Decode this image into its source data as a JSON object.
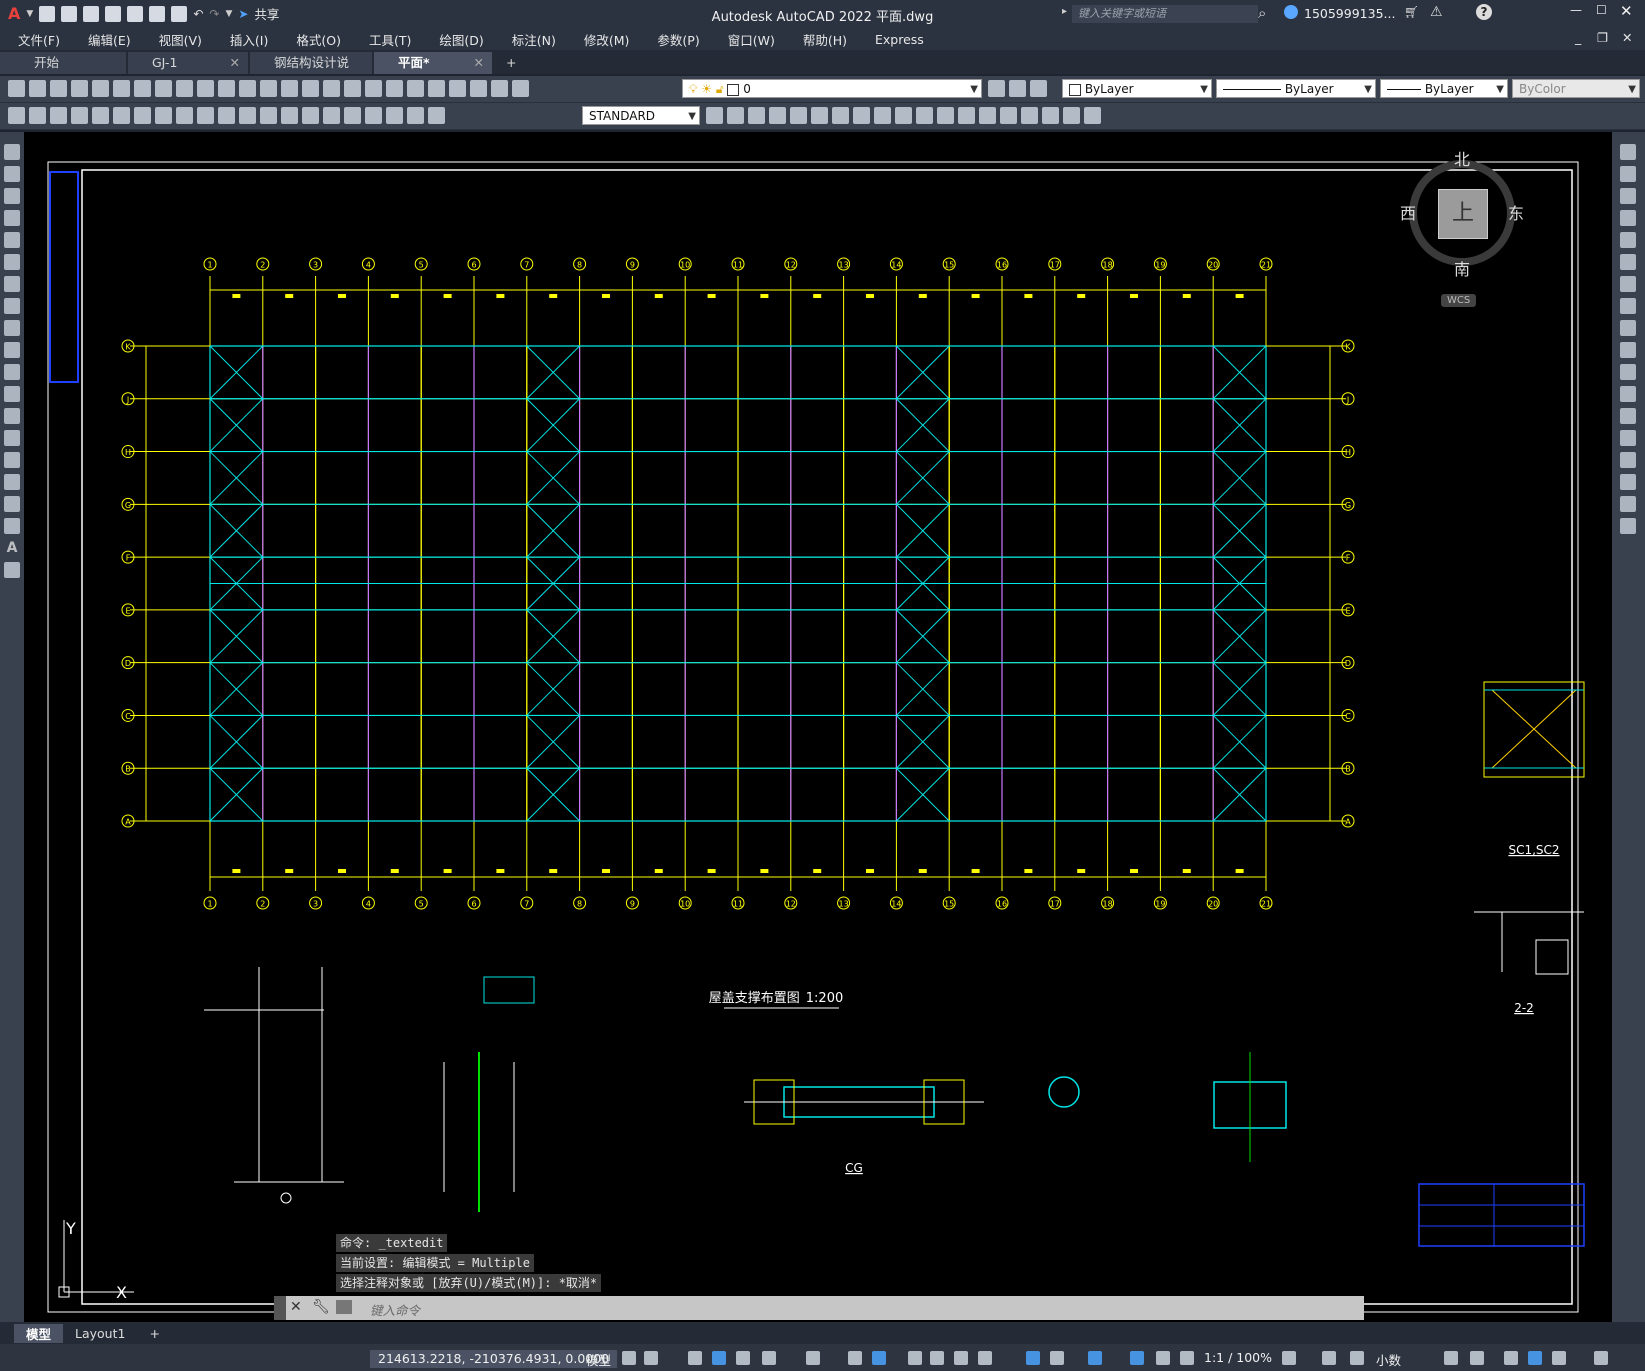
{
  "titlebar": {
    "app_title": "Autodesk AutoCAD 2022    平面.dwg",
    "share_label": "共享",
    "search_placeholder": "键入关键字或短语",
    "user_name": "1505999135...",
    "help_icon": "help-icon"
  },
  "menu": [
    "文件(F)",
    "编辑(E)",
    "视图(V)",
    "插入(I)",
    "格式(O)",
    "工具(T)",
    "绘图(D)",
    "标注(N)",
    "修改(M)",
    "参数(P)",
    "窗口(W)",
    "帮助(H)",
    "Express"
  ],
  "tabs": [
    {
      "label": "开始",
      "active": false,
      "closable": false
    },
    {
      "label": "GJ-1",
      "active": false,
      "closable": true
    },
    {
      "label": "钢结构设计说明",
      "active": false,
      "closable": true
    },
    {
      "label": "平面*",
      "active": true,
      "closable": true
    }
  ],
  "layer_toolbar": {
    "layer_value": "0",
    "color_value": "ByLayer",
    "linetype_value": "ByLayer",
    "lineweight_value": "ByLayer",
    "plotstyle_value": "ByColor",
    "textstyle_value": "STANDARD"
  },
  "viewcube": {
    "north": "北",
    "south": "南",
    "east": "东",
    "west": "西",
    "face": "上",
    "wcs_label": "WCS"
  },
  "drawing": {
    "title": "屋盖支撑布置图",
    "scale": "1:200",
    "grid_x_labels": [
      "1",
      "2",
      "3",
      "4",
      "5",
      "6",
      "7",
      "8",
      "9",
      "10",
      "11",
      "12",
      "13",
      "14",
      "15",
      "16",
      "17",
      "18",
      "19",
      "20",
      "21"
    ],
    "grid_y_labels": [
      "K",
      "J",
      "H",
      "G",
      "F",
      "E",
      "D",
      "C",
      "B",
      "A"
    ],
    "detail_labels": [
      "SC1,SC2",
      "2-2",
      "CG"
    ],
    "colors": {
      "grid": "#ffff00",
      "beam": "#00e5e5",
      "purlin": "#c878ff",
      "frame": "#ffffff",
      "detail_green": "#00dd00"
    }
  },
  "command": {
    "history": [
      "命令:  _textedit",
      "当前设置: 编辑模式 = Multiple",
      "选择注释对象或 [放弃(U)/模式(M)]: *取消*"
    ],
    "input_placeholder": "键入命令"
  },
  "layout_tabs": [
    "模型",
    "Layout1"
  ],
  "status": {
    "coordinates": "214613.2218, -210376.4931, 0.0000",
    "model_label": "模型",
    "scale": "1:1 / 100%",
    "units": "小数"
  },
  "ucs": {
    "x_label": "X",
    "y_label": "Y"
  }
}
